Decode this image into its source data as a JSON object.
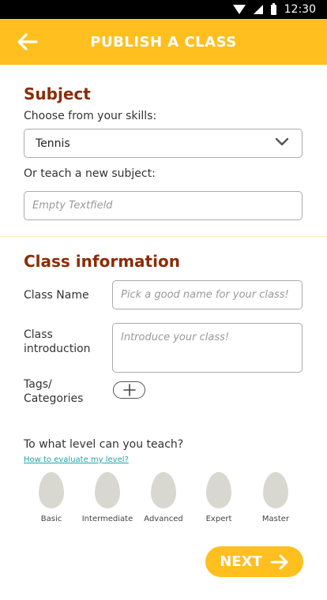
{
  "status_bar": {
    "time": "12:30"
  },
  "app_bar": {
    "title": "PUBLISH A CLASS"
  },
  "subject": {
    "heading": "Subject",
    "choose_label": "Choose from your skills:",
    "selected_skill": "Tennis",
    "new_label": "Or teach a new subject:",
    "new_placeholder": "Empty Textfield"
  },
  "class_info": {
    "heading": "Class information",
    "name_label": "Class Name",
    "name_placeholder": "Pick a good name for your class!",
    "intro_label_line1": "Class",
    "intro_label_line2": "introduction",
    "intro_placeholder": "Introduce your class!",
    "tags_label_line1": "Tags/",
    "tags_label_line2": "Categories"
  },
  "level": {
    "question": "To what level can you teach?",
    "help_link": "How to evaluate my level?",
    "options": [
      "Basic",
      "Intermediate",
      "Advanced",
      "Expert",
      "Master"
    ]
  },
  "next_button": {
    "label": "NEXT"
  },
  "colors": {
    "accent": "#FFBF1F",
    "heading": "#8B2C08",
    "link": "#1FA6A6",
    "egg": "#D8D8D0"
  }
}
